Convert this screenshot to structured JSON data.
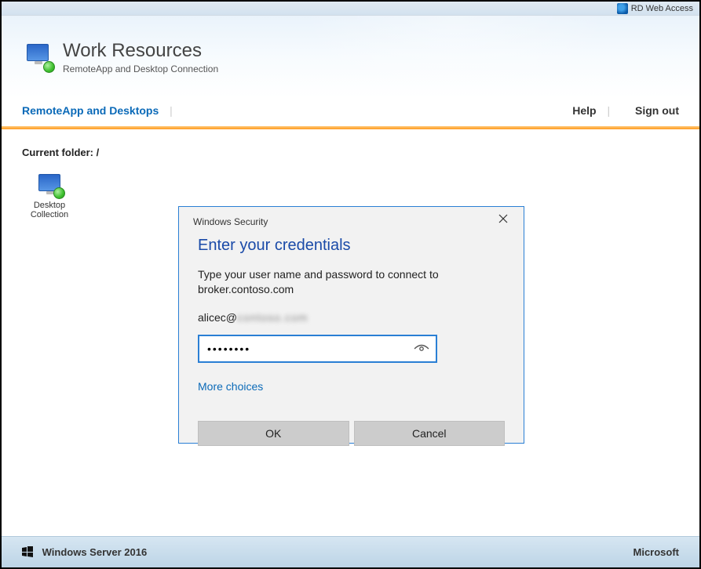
{
  "topbar": {
    "label": "RD Web Access"
  },
  "banner": {
    "title": "Work Resources",
    "subtitle": "RemoteApp and Desktop Connection"
  },
  "nav": {
    "left_tab": "RemoteApp and Desktops",
    "help": "Help",
    "signout": "Sign out"
  },
  "content": {
    "folder_label": "Current folder: /",
    "apps": [
      {
        "label": "Desktop Collection"
      }
    ]
  },
  "dialog": {
    "window_title": "Windows Security",
    "heading": "Enter your credentials",
    "message": "Type your user name and password to connect to broker.contoso.com",
    "username_prefix": "alicec@",
    "username_blurred": "contoso.com",
    "password_value": "••••••••",
    "more_choices": "More choices",
    "ok": "OK",
    "cancel": "Cancel"
  },
  "footer": {
    "left": "Windows Server 2016",
    "right": "Microsoft"
  }
}
